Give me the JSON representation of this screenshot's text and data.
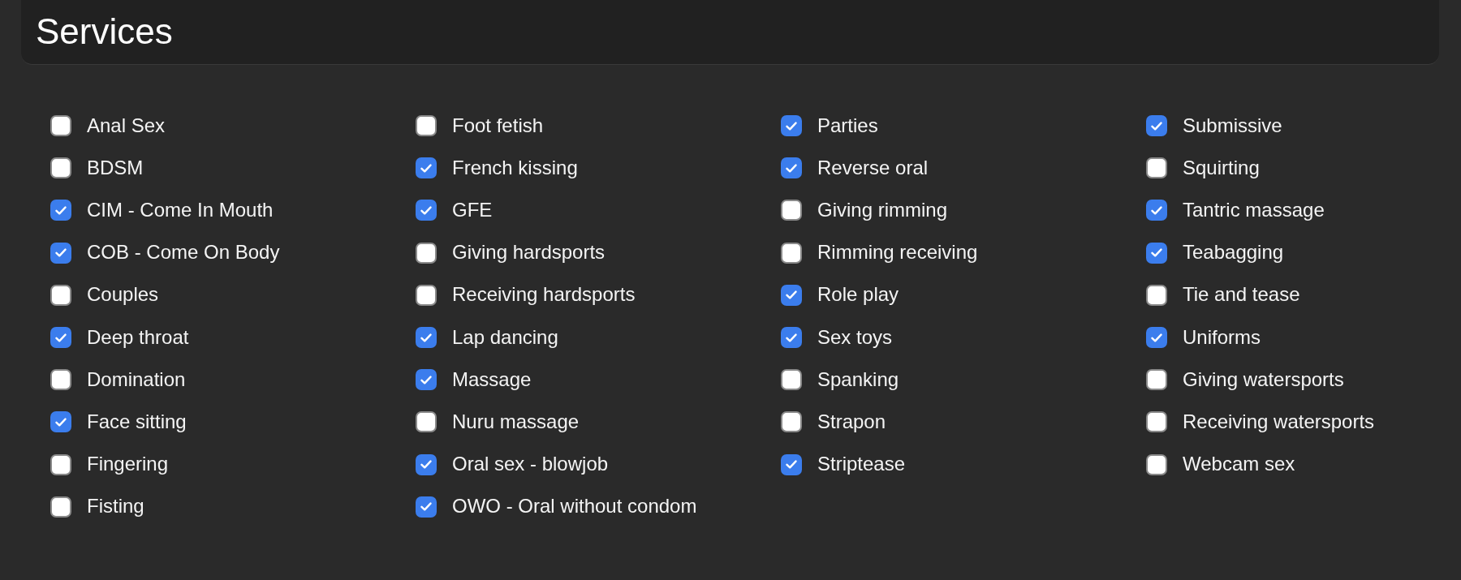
{
  "header": {
    "title": "Services"
  },
  "columns": [
    {
      "items": [
        {
          "label": "Anal Sex",
          "checked": false
        },
        {
          "label": "BDSM",
          "checked": false
        },
        {
          "label": "CIM - Come In Mouth",
          "checked": true
        },
        {
          "label": "COB - Come On Body",
          "checked": true
        },
        {
          "label": "Couples",
          "checked": false
        },
        {
          "label": "Deep throat",
          "checked": true
        },
        {
          "label": "Domination",
          "checked": false
        },
        {
          "label": "Face sitting",
          "checked": true
        },
        {
          "label": "Fingering",
          "checked": false
        },
        {
          "label": "Fisting",
          "checked": false
        }
      ]
    },
    {
      "items": [
        {
          "label": "Foot fetish",
          "checked": false
        },
        {
          "label": "French kissing",
          "checked": true
        },
        {
          "label": "GFE",
          "checked": true
        },
        {
          "label": "Giving hardsports",
          "checked": false
        },
        {
          "label": "Receiving hardsports",
          "checked": false
        },
        {
          "label": "Lap dancing",
          "checked": true
        },
        {
          "label": "Massage",
          "checked": true
        },
        {
          "label": "Nuru massage",
          "checked": false
        },
        {
          "label": "Oral sex - blowjob",
          "checked": true
        },
        {
          "label": "OWO - Oral without condom",
          "checked": true
        }
      ]
    },
    {
      "items": [
        {
          "label": "Parties",
          "checked": true
        },
        {
          "label": "Reverse oral",
          "checked": true
        },
        {
          "label": "Giving rimming",
          "checked": false
        },
        {
          "label": "Rimming receiving",
          "checked": false
        },
        {
          "label": "Role play",
          "checked": true
        },
        {
          "label": "Sex toys",
          "checked": true
        },
        {
          "label": "Spanking",
          "checked": false
        },
        {
          "label": "Strapon",
          "checked": false
        },
        {
          "label": "Striptease",
          "checked": true
        }
      ]
    },
    {
      "items": [
        {
          "label": "Submissive",
          "checked": true
        },
        {
          "label": "Squirting",
          "checked": false
        },
        {
          "label": "Tantric massage",
          "checked": true
        },
        {
          "label": "Teabagging",
          "checked": true
        },
        {
          "label": "Tie and tease",
          "checked": false
        },
        {
          "label": "Uniforms",
          "checked": true
        },
        {
          "label": "Giving watersports",
          "checked": false
        },
        {
          "label": "Receiving watersports",
          "checked": false
        },
        {
          "label": "Webcam sex",
          "checked": false
        }
      ]
    }
  ]
}
